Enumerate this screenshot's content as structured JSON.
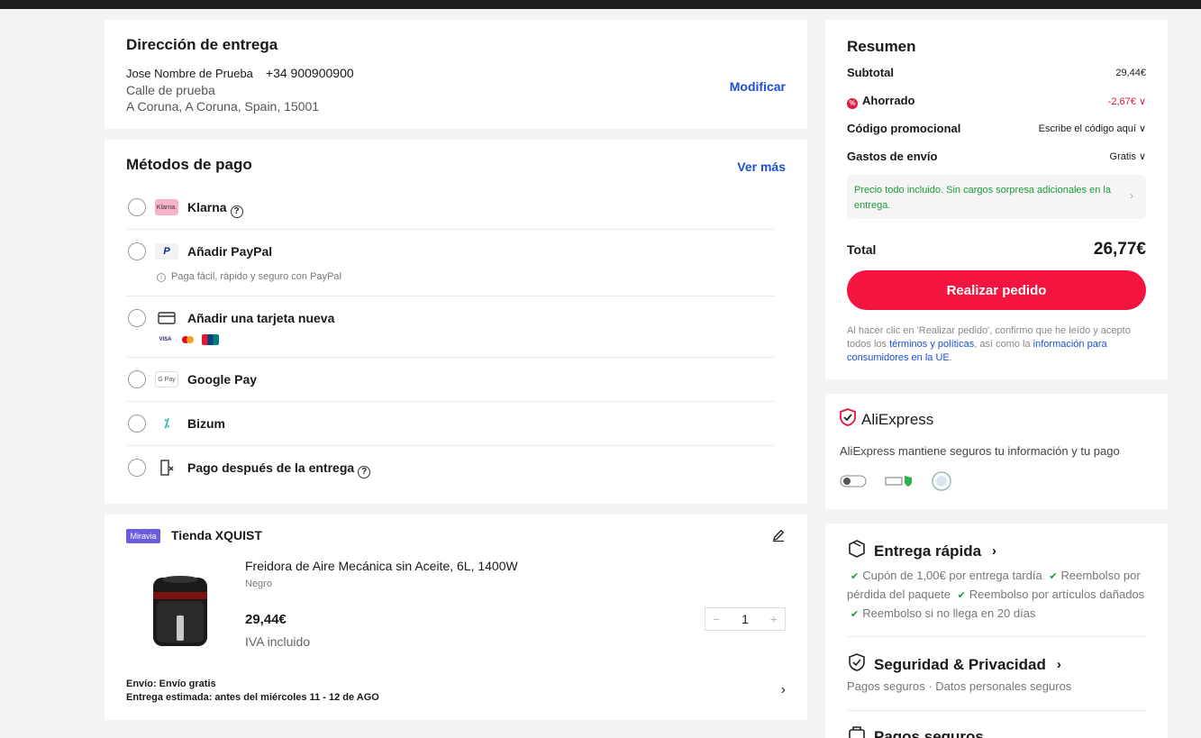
{
  "address": {
    "title": "Dirección de entrega",
    "name": "Jose Nombre de Prueba",
    "phone": "+34 900900900",
    "street": "Calle de prueba",
    "city": "A Coruna, A Coruna, Spain, 15001",
    "modify": "Modificar"
  },
  "payment": {
    "title": "Métodos de pago",
    "see_more": "Ver más",
    "methods": [
      {
        "label": "Klarna",
        "logo": "Klarna."
      },
      {
        "label": "Añadir PayPal",
        "note": "Paga fácil, rápido y seguro con PayPal"
      },
      {
        "label": "Añadir una tarjeta nueva",
        "cards": [
          "VISA",
          "MC",
          "UP"
        ]
      },
      {
        "label": "Google Pay",
        "logo": "G Pay"
      },
      {
        "label": "Bizum"
      },
      {
        "label": "Pago después de la entrega"
      }
    ]
  },
  "store": {
    "badge": "Miravia",
    "name": "Tienda XQUIST",
    "product_title": "Freidora de Aire Mecánica sin Aceite, 6L, 1400W",
    "product_color": "Negro",
    "price": "29,44€",
    "tax_note": "IVA incluido",
    "quantity": "1",
    "shipping": "Envío: Envío gratis",
    "delivery": "Entrega estimada: antes del miércoles 11 - 12 de AGO"
  },
  "summary": {
    "title": "Resumen",
    "subtotal_label": "Subtotal",
    "subtotal_value": "29,44€",
    "saved_label": "Ahorrado",
    "saved_value": "-2,67€",
    "promo_label": "Código promocional",
    "promo_value": "Escribe el código aquí",
    "shipping_label": "Gastos de envío",
    "shipping_value": "Gratis",
    "info": "Precio todo incluido. Sin cargos sorpresa adicionales en la entrega.",
    "total_label": "Total",
    "total_value": "26,77€",
    "order_button": "Realizar pedido",
    "legal_1": "Al hacer clic en 'Realizar pedido', confirmo que he leído y acepto todos los ",
    "legal_link_1": "términos y políticas",
    "legal_2": ", así como la ",
    "legal_link_2": "información para consumidores en la UE",
    "legal_3": "."
  },
  "trust": {
    "brand": "AliExpress",
    "text": "AliExpress mantiene seguros tu información y tu pago"
  },
  "benefits": {
    "fast_title": "Entrega rápida",
    "fast_items": [
      "Cupón de 1,00€ por entrega tardía",
      "Reembolso por pérdida del paquete",
      "Reembolso por artículos dañados",
      "Reembolso si no llega en 20 días"
    ],
    "security_title": "Seguridad & Privacidad",
    "security_text": "Pagos seguros · Datos personales seguros",
    "payments_title": "Pagos seguros"
  },
  "colors": {
    "accent": "#f3153f",
    "link": "#1a4fd6",
    "success": "#1a9c3a"
  }
}
